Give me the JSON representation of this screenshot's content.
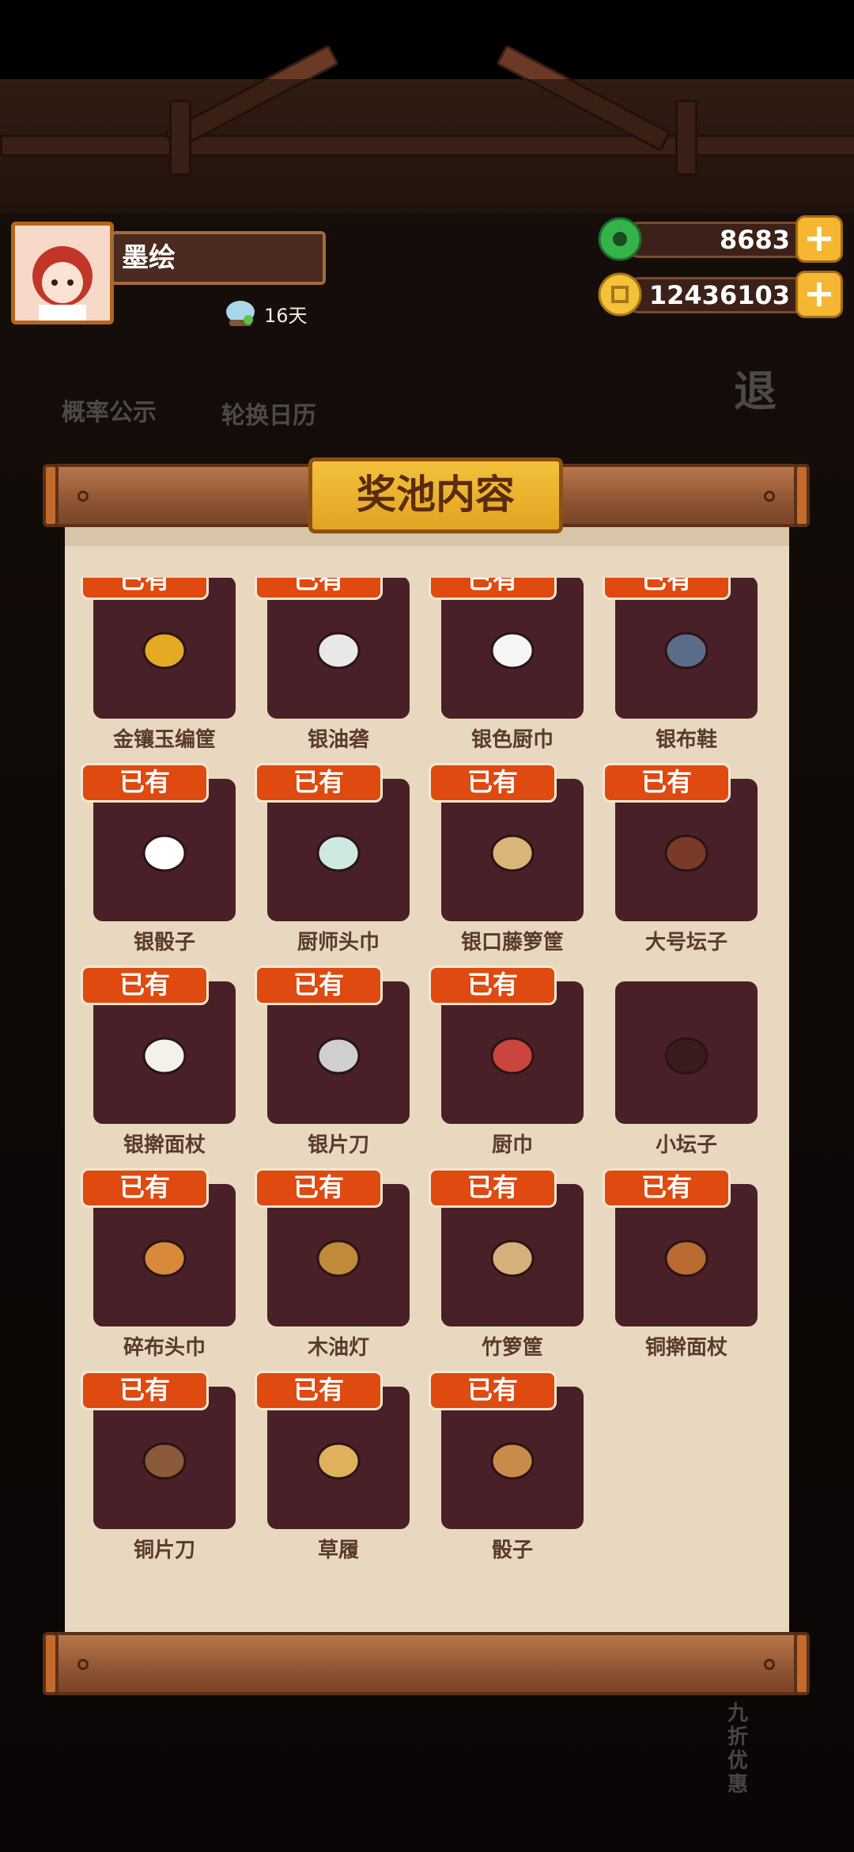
{
  "player": {
    "name": "墨绘",
    "days": "16天"
  },
  "currency": {
    "jade": "8683",
    "coins": "12436103",
    "plus": "+"
  },
  "background_labels": {
    "probability": "概率公示",
    "calendar": "轮换日历",
    "exit": "退",
    "discount": "九折优惠"
  },
  "modal": {
    "title": "奖池内容"
  },
  "owned_badge": "已有",
  "items": [
    {
      "name": "金镶玉编筐",
      "owned": true,
      "icon": "gold-basket-icon"
    },
    {
      "name": "银油砻",
      "owned": true,
      "icon": "silver-oil-lamp-icon"
    },
    {
      "name": "银色厨巾",
      "owned": true,
      "icon": "silver-cloth-icon"
    },
    {
      "name": "银布鞋",
      "owned": true,
      "icon": "silver-shoe-icon"
    },
    {
      "name": "银骰子",
      "owned": true,
      "icon": "silver-dice-icon"
    },
    {
      "name": "厨师头巾",
      "owned": true,
      "icon": "chef-headscarf-icon"
    },
    {
      "name": "银口藤箩筐",
      "owned": true,
      "icon": "rattan-basket-icon"
    },
    {
      "name": "大号坛子",
      "owned": true,
      "icon": "large-jar-icon"
    },
    {
      "name": "银擀面杖",
      "owned": true,
      "icon": "silver-rolling-pin-icon"
    },
    {
      "name": "银片刀",
      "owned": true,
      "icon": "silver-cleaver-icon"
    },
    {
      "name": "厨巾",
      "owned": true,
      "icon": "kitchen-cloth-icon"
    },
    {
      "name": "小坛子",
      "owned": false,
      "icon": "small-jar-icon"
    },
    {
      "name": "碎布头巾",
      "owned": true,
      "icon": "rag-headscarf-icon"
    },
    {
      "name": "木油灯",
      "owned": true,
      "icon": "wooden-oil-lamp-icon"
    },
    {
      "name": "竹箩筐",
      "owned": true,
      "icon": "bamboo-basket-icon"
    },
    {
      "name": "铜擀面杖",
      "owned": true,
      "icon": "copper-rolling-pin-icon"
    },
    {
      "name": "铜片刀",
      "owned": true,
      "icon": "copper-cleaver-icon"
    },
    {
      "name": "草履",
      "owned": true,
      "icon": "straw-sandals-icon"
    },
    {
      "name": "骰子",
      "owned": true,
      "icon": "dice-icon"
    }
  ]
}
